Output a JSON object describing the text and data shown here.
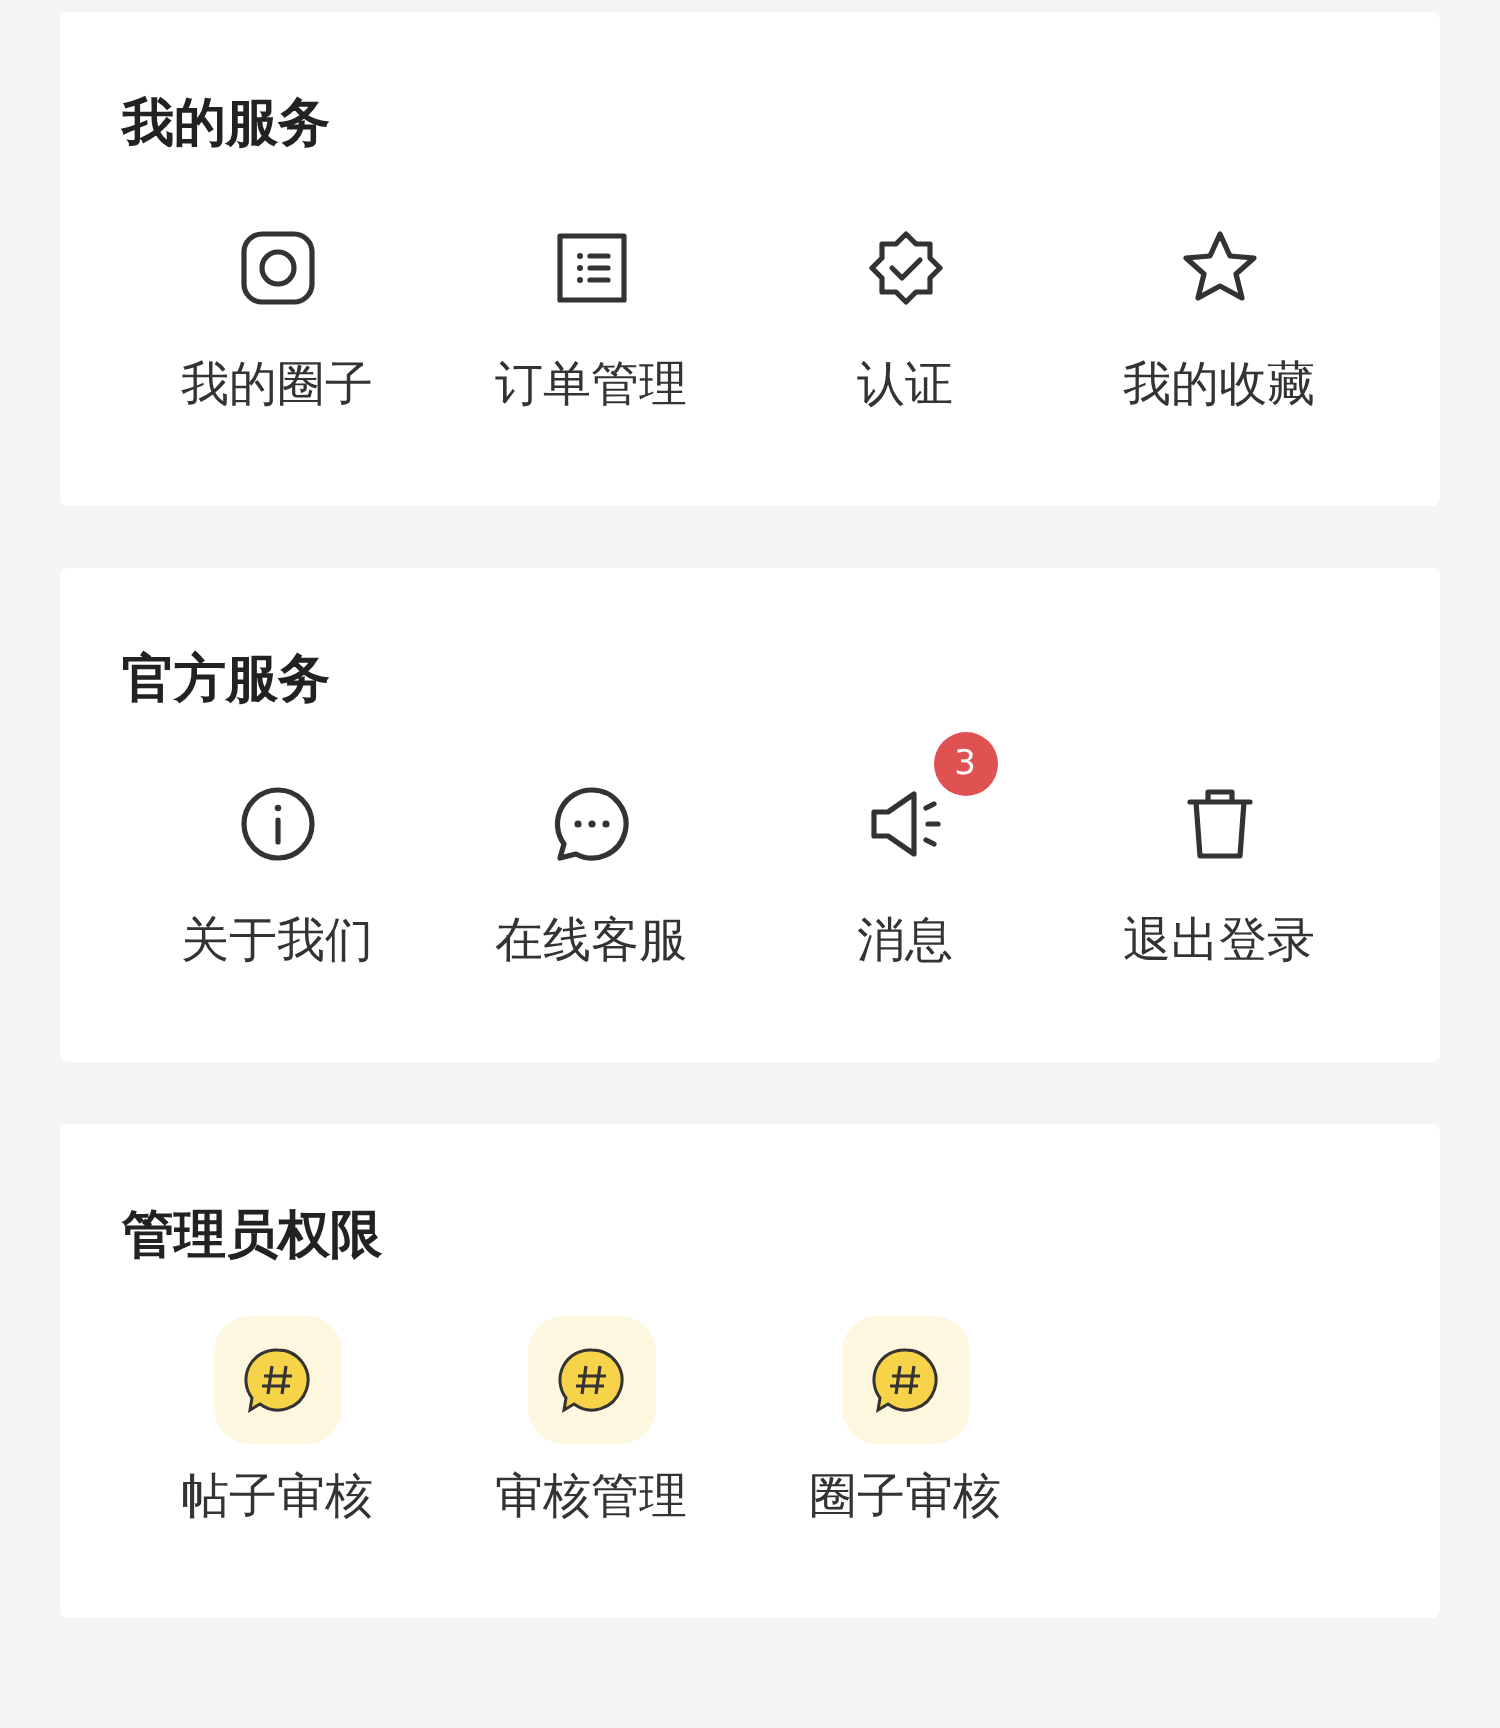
{
  "sections": [
    {
      "title": "我的服务",
      "items": [
        {
          "kind": "line",
          "label": "我的圈子"
        },
        {
          "kind": "line",
          "label": "订单管理"
        },
        {
          "kind": "line",
          "label": "认证"
        },
        {
          "kind": "line",
          "label": "我的收藏"
        }
      ]
    },
    {
      "title": "官方服务",
      "items": [
        {
          "kind": "line",
          "label": "关于我们"
        },
        {
          "kind": "line",
          "label": "在线客服"
        },
        {
          "kind": "line",
          "label": "消息",
          "badge": "3"
        },
        {
          "kind": "line",
          "label": "退出登录"
        }
      ]
    },
    {
      "title": "管理员权限",
      "items": [
        {
          "kind": "bubble",
          "label": "帖子审核"
        },
        {
          "kind": "bubble",
          "label": "审核管理"
        },
        {
          "kind": "bubble",
          "label": "圈子审核"
        }
      ]
    }
  ]
}
